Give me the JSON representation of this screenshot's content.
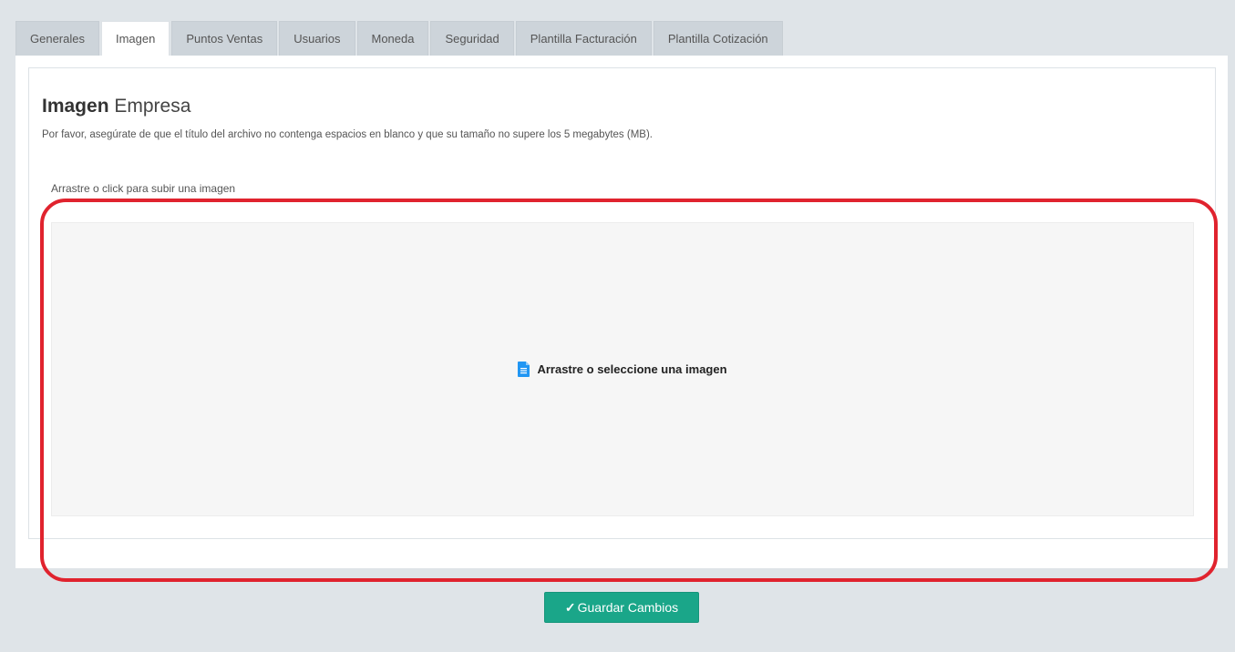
{
  "tabs": [
    {
      "label": "Generales",
      "active": false
    },
    {
      "label": "Imagen",
      "active": true
    },
    {
      "label": "Puntos Ventas",
      "active": false
    },
    {
      "label": "Usuarios",
      "active": false
    },
    {
      "label": "Moneda",
      "active": false
    },
    {
      "label": "Seguridad",
      "active": false
    },
    {
      "label": "Plantilla Facturación",
      "active": false
    },
    {
      "label": "Plantilla Cotización",
      "active": false
    }
  ],
  "card": {
    "title_strong": "Imagen",
    "title_light": "Empresa",
    "description": "Por favor, asegúrate de que el título del archivo no contenga espacios en blanco y que su tamaño no supere los 5 megabytes (MB).",
    "upload_label": "Arrastre o click para subir una imagen"
  },
  "dropzone": {
    "icon": "file-icon",
    "text": "Arrastre o seleccione una imagen"
  },
  "actions": {
    "save_label": "Guardar Cambios",
    "save_icon": "check-icon"
  },
  "colors": {
    "highlight": "#e0232e",
    "save_button": "#1aa689",
    "file_icon": "#2196f3"
  }
}
